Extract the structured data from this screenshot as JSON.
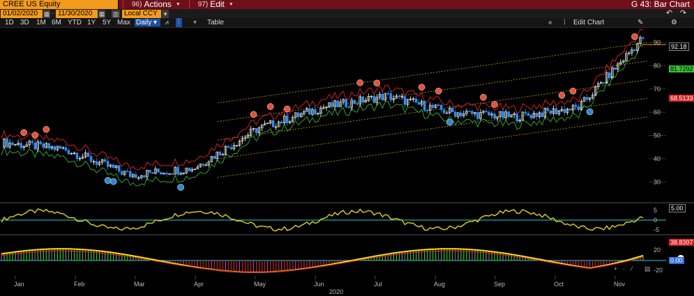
{
  "topbar": {
    "ticker": "CREE US Equity",
    "menus": [
      {
        "num": "96)",
        "label": "Actions"
      },
      {
        "num": "97)",
        "label": "Edit"
      }
    ],
    "title": "G 43: Bar Chart"
  },
  "toolbar": {
    "start_date": "01/02/2020",
    "end_date": "11/30/2020",
    "currency": "Local CCY"
  },
  "ranges": [
    "1D",
    "3D",
    "1M",
    "6M",
    "YTD",
    "1Y",
    "5Y",
    "Max"
  ],
  "frequency": "Daily",
  "table_label": "Table",
  "edit_chart_label": "Edit Chart",
  "icons": {
    "back": "undo-icon",
    "refresh": "redo-icon",
    "settings": "gear-icon",
    "pencil": "pencil-icon",
    "collapse": "double-chevron-left-icon",
    "grid": "grid-icon"
  },
  "price_axis": {
    "ticks": [
      30,
      40,
      50,
      60,
      70,
      80,
      90
    ]
  },
  "price_tags": [
    {
      "value": "92.18",
      "color": "#ffffff",
      "bg": "#000000"
    },
    {
      "value": "81.7292",
      "color": "#000000",
      "bg": "#36c236"
    },
    {
      "value": "68.5133",
      "color": "#ffffff",
      "bg": "#d21f1f"
    }
  ],
  "osc1": {
    "ticks": [
      "5",
      "0",
      "-5"
    ],
    "tag": "5.00"
  },
  "osc2": {
    "ticks": [
      "20",
      "-20"
    ],
    "tags": [
      "38.8397",
      "0.00"
    ]
  },
  "x_axis": {
    "months": [
      "Jan",
      "Feb",
      "Mar",
      "Apr",
      "May",
      "Jun",
      "Jul",
      "Aug",
      "Sep",
      "Oct",
      "Nov"
    ],
    "year": "2020"
  },
  "colors": {
    "up": "#ffffff",
    "down": "#2a8df0",
    "trail_red": "#d21f1f",
    "trail_green": "#2fa32f",
    "channel": "#b5a21a"
  },
  "chart_data": {
    "type": "candlestick",
    "ticker": "CREE US Equity",
    "frequency": "Daily",
    "ylim": [
      22,
      96
    ],
    "monthly_closes": {
      "x": [
        "Jan",
        "Feb",
        "Mar",
        "Apr",
        "May",
        "Jun",
        "Jul",
        "Aug",
        "Sep",
        "Oct",
        "Nov"
      ],
      "values": [
        47,
        44,
        33,
        36,
        53,
        62,
        67,
        60,
        58,
        62,
        92.18
      ]
    }
  }
}
